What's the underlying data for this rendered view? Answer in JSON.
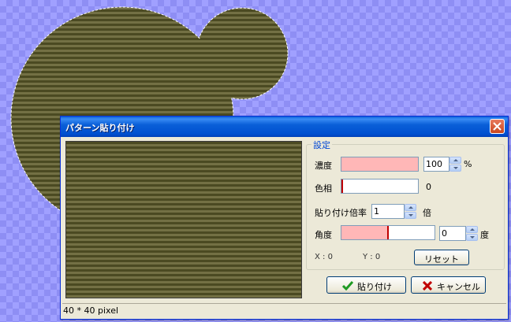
{
  "dialog": {
    "title": "パターン貼り付け",
    "close_glyph": "×",
    "status_text": "40 * 40 pixel"
  },
  "settings": {
    "group_label": "設定",
    "density_label": "濃度",
    "density_value": "100",
    "density_unit": "%",
    "density_fill": 1.0,
    "hue_label": "色相",
    "hue_value": "0",
    "scale_label": "貼り付け倍率",
    "scale_value": "1",
    "scale_unit": "倍",
    "angle_label": "角度",
    "angle_value": "0",
    "angle_unit": "度",
    "angle_fill": 0.5,
    "x_readout": "X : 0",
    "y_readout": "Y : 0",
    "reset_label": "リセット"
  },
  "buttons": {
    "paste_label": "貼り付け",
    "cancel_label": "キャンセル"
  },
  "icons": {
    "paste": "check-icon",
    "cancel": "x-icon"
  },
  "colors": {
    "titlebar": "#0a5fd8",
    "slider_fill": "#ffb7b7",
    "slider_marker": "#c00000",
    "pattern_dark": "#4b4a22",
    "pattern_light": "#737044"
  }
}
